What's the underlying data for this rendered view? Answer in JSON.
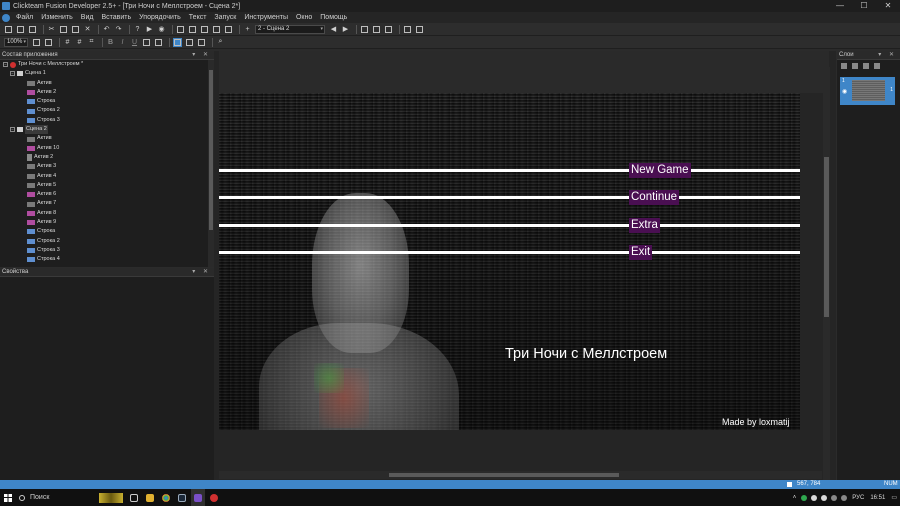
{
  "window": {
    "title": "Clickteam Fusion Developer 2.5+ - [Три Ночи с Меллстроем - Сцена 2*]",
    "minimize": "—",
    "maximize": "☐",
    "close": "✕"
  },
  "menu": [
    "Файл",
    "Изменить",
    "Вид",
    "Вставить",
    "Упорядочить",
    "Текст",
    "Запуск",
    "Инструменты",
    "Окно",
    "Помощь"
  ],
  "toolbar": {
    "zoom": "100%",
    "frame_select": "2 - Сцена 2",
    "bold": "B",
    "italic": "I",
    "underline": "U"
  },
  "workspace": {
    "header": "Состав приложения",
    "buttons": "▾ ✕",
    "items": [
      {
        "label": "Три Ночи с Меллстроем *",
        "icon": "app-icon",
        "level": 0,
        "toggle": "−"
      },
      {
        "label": "Сцена 1",
        "icon": "frame-icon",
        "level": 1,
        "toggle": "−"
      },
      {
        "label": "Актив",
        "icon": "active-object-icon",
        "level": 2
      },
      {
        "label": "Актив 2",
        "icon": "active-object-icon-pink",
        "level": 2
      },
      {
        "label": "Строка",
        "icon": "string-object-icon",
        "level": 2
      },
      {
        "label": "Строка 2",
        "icon": "string-object-icon",
        "level": 2
      },
      {
        "label": "Строка 3",
        "icon": "string-object-icon",
        "level": 2
      },
      {
        "label": "Сцена 2",
        "icon": "frame-icon",
        "level": 1,
        "toggle": "−",
        "selected": true
      },
      {
        "label": "Актив",
        "icon": "active-object-icon",
        "level": 2
      },
      {
        "label": "Актив 10",
        "icon": "active-object-icon-pink",
        "level": 2
      },
      {
        "label": "Актив 2",
        "icon": "person-object-icon",
        "level": 2
      },
      {
        "label": "Актив 3",
        "icon": "active-object-icon",
        "level": 2
      },
      {
        "label": "Актив 4",
        "icon": "active-object-icon",
        "level": 2
      },
      {
        "label": "Актив 5",
        "icon": "active-object-icon",
        "level": 2
      },
      {
        "label": "Актив 6",
        "icon": "active-object-icon-pink",
        "level": 2
      },
      {
        "label": "Актив 7",
        "icon": "active-object-icon",
        "level": 2
      },
      {
        "label": "Актив 8",
        "icon": "active-object-icon-pink",
        "level": 2
      },
      {
        "label": "Актив 9",
        "icon": "active-object-icon-pink",
        "level": 2
      },
      {
        "label": "Строка",
        "icon": "string-object-icon",
        "level": 2
      },
      {
        "label": "Строка 2",
        "icon": "string-object-icon",
        "level": 2
      },
      {
        "label": "Строка 3",
        "icon": "string-object-icon",
        "level": 2
      },
      {
        "label": "Строка 4",
        "icon": "string-object-icon",
        "level": 2
      }
    ]
  },
  "properties": {
    "header": "Свойства",
    "buttons": "▾ ✕"
  },
  "frame_editor": {
    "menu_items": [
      "New Game",
      "Continue",
      "Extra",
      "Exit"
    ],
    "game_title": "Три Ночи с Меллстроем",
    "credit": "Made by loxmatij",
    "highlight_color": "#4a0f52"
  },
  "layers": {
    "header": "Слои",
    "buttons": "▾ ✕",
    "layer_number": "1",
    "layer_count": "1",
    "visibility_icon": "◉"
  },
  "status": {
    "coords": "567, 784",
    "num": "NUM"
  },
  "taskbar": {
    "search": "Поиск",
    "lang": "РУС",
    "time": "16:51"
  }
}
